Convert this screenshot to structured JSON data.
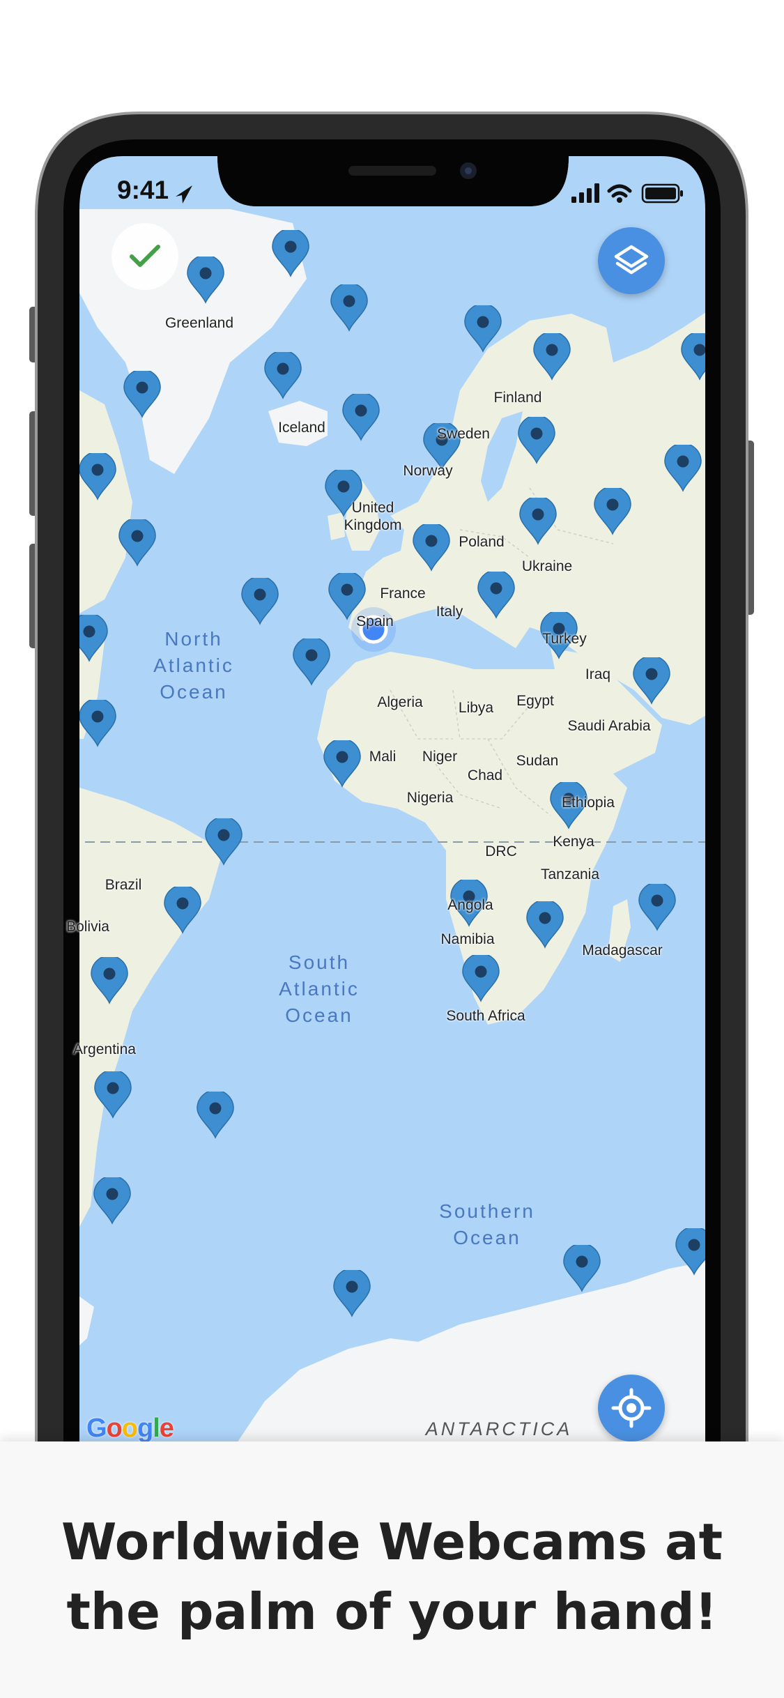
{
  "status_bar": {
    "time": "9:41"
  },
  "map": {
    "labels": {
      "greenland": "Greenland",
      "iceland": "Iceland",
      "finland": "Finland",
      "sweden": "Sweden",
      "norway": "Norway",
      "united_kingdom": "United\nKingdom",
      "poland": "Poland",
      "ukraine": "Ukraine",
      "france": "France",
      "italy": "Italy",
      "spain": "Spain",
      "turkey": "Turkey",
      "iraq": "Iraq",
      "algeria": "Algeria",
      "libya": "Libya",
      "egypt": "Egypt",
      "saudi_arabia": "Saudi Arabia",
      "mali": "Mali",
      "niger": "Niger",
      "sudan": "Sudan",
      "chad": "Chad",
      "nigeria": "Nigeria",
      "ethiopia": "Ethiopia",
      "kenya": "Kenya",
      "drc": "DRC",
      "tanzania": "Tanzania",
      "brazil": "Brazil",
      "bolivia": "Bolivia",
      "angola": "Angola",
      "namibia": "Namibia",
      "madagascar": "Madagascar",
      "south_africa": "South Africa",
      "argentina": "Argentina",
      "north_atlantic": "North\nAtlantic\nOcean",
      "south_atlantic": "South\nAtlantic\nOcean",
      "southern_ocean": "Southern\nOcean",
      "antarctica": "ANTARCTICA"
    },
    "attribution": {
      "g1": "G",
      "o1": "o",
      "o2": "o",
      "g2": "g",
      "l": "l",
      "e": "e"
    }
  },
  "controls": {
    "check_icon": "checkmark-icon",
    "layers_icon": "layers-icon",
    "locate_icon": "crosshair-icon"
  },
  "colors": {
    "ocean": "#aed4f8",
    "land": "#eef0e2",
    "ice": "#f4f5f6",
    "pin": "#3d8fd1",
    "pin_dot": "#1c3f63",
    "accent": "#4a90e2",
    "user_location": "#4285f4"
  },
  "caption": {
    "line1": "Worldwide Webcams at",
    "line2": "the palm of your hand!"
  }
}
